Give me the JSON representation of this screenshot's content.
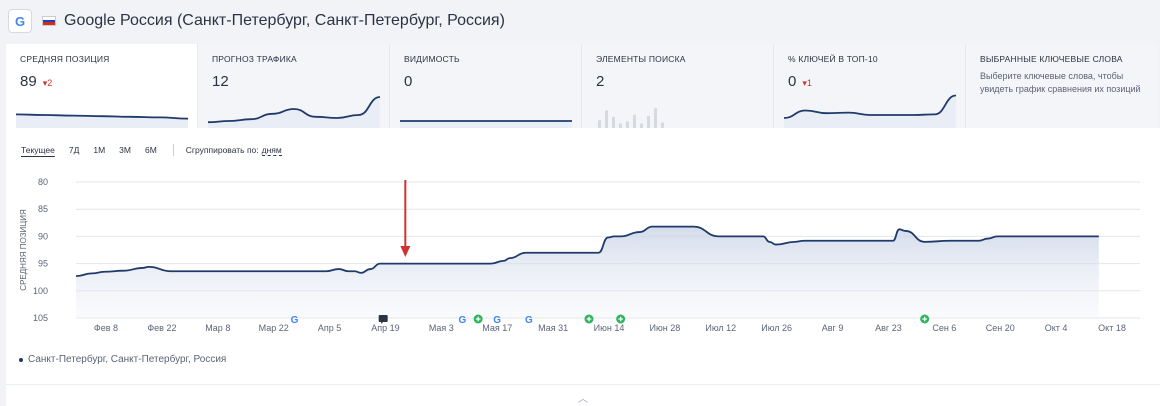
{
  "header": {
    "engine_icon": "G",
    "flag_icon": "russia-flag-icon",
    "title": "Google Россия (Санкт-Петербург, Санкт-Петербург, Россия)"
  },
  "cards": [
    {
      "label": "Средняя позиция",
      "value": "89",
      "delta": "▾2",
      "spark": [
        0.32,
        0.3,
        0.28,
        0.26,
        0.24,
        0.22,
        0.18
      ]
    },
    {
      "label": "Прогноз трафика",
      "value": "12",
      "spark": [
        0.06,
        0.1,
        0.16,
        0.34,
        0.5,
        0.24,
        0.2,
        0.3,
        0.9
      ]
    },
    {
      "label": "Видимость",
      "value": "0",
      "spark": [
        0.1,
        0.1,
        0.1,
        0.1,
        0.1,
        0.1,
        0.1
      ]
    },
    {
      "label": "Элементы поиска",
      "value": "2",
      "bars": [
        0.35,
        0.8,
        0.5,
        0.2,
        0.3,
        0.6,
        0.2,
        0.55,
        0.9,
        0.25
      ]
    },
    {
      "label": "% ключей в ТОП-10",
      "value": "0",
      "delta": "▾1",
      "spark": [
        0.2,
        0.45,
        0.36,
        0.38,
        0.3,
        0.3,
        0.3,
        0.32,
        0.95
      ]
    },
    {
      "label": "Выбранные ключевые слова",
      "note": "Выберите ключевые слова, чтобы увидеть график сравнения их позиций"
    }
  ],
  "ranges": {
    "options": [
      "Текущее",
      "7Д",
      "1М",
      "3М",
      "6М"
    ],
    "group_label": "Сгруппировать по:",
    "group_value": "дням"
  },
  "chart_data": {
    "type": "area",
    "ylabel": "Средняя позиция",
    "y_ticks": [
      80,
      85,
      90,
      95,
      100,
      105
    ],
    "ylim": [
      80,
      105
    ],
    "y_inverted": true,
    "x_ticks": [
      "Фев 8",
      "Фев 22",
      "Мар 8",
      "Мар 22",
      "Апр 5",
      "Апр 19",
      "Мая 3",
      "Мая 17",
      "Мая 31",
      "Июн 14",
      "Июн 28",
      "Июл 12",
      "Июл 26",
      "Авг 9",
      "Авг 23",
      "Сен 6",
      "Сен 20",
      "Окт 4",
      "Окт 18"
    ],
    "series": [
      {
        "name": "Санкт-Петербург, Санкт-Петербург, Россия",
        "color": "#1f3a6b",
        "x": [
          0,
          5,
          9,
          15,
          21,
          23,
          30,
          36,
          43,
          44,
          46,
          50,
          54,
          60,
          73,
          79,
          83,
          86,
          88,
          90,
          93,
          96,
          100,
          107,
          114,
          120,
          121,
          123,
          124,
          128,
          131,
          135,
          137,
          142,
          145,
          148,
          152,
          155,
          163,
          165,
          168,
          170,
          172,
          178,
          182,
          189,
          195,
          203,
          212,
          216,
          217,
          219,
          221,
          227,
          230,
          233,
          243,
          248,
          255,
          258,
          260,
          262,
          268,
          276,
          282,
          284,
          285,
          288,
          291,
          298,
          304,
          307,
          310,
          312,
          315,
          318,
          322,
          323
        ],
        "y": [
          97.3,
          96.8,
          96.5,
          96.3,
          95.8,
          95.6,
          96.4,
          96.4,
          96.4,
          96.4,
          96.4,
          96.4,
          96.4,
          96.4,
          96.4,
          96.4,
          96.0,
          96.4,
          96.4,
          96.7,
          96.0,
          95.0,
          95.0,
          95.0,
          95.0,
          95.0,
          95.0,
          95.0,
          95.0,
          95.0,
          95.0,
          94.5,
          94.0,
          93.0,
          93.0,
          93.0,
          93.0,
          93.0,
          93.0,
          93.0,
          90.2,
          90.0,
          90.0,
          89.2,
          88.2,
          88.2,
          88.2,
          90.0,
          90.0,
          90.0,
          90.0,
          91.0,
          91.5,
          91.0,
          90.8,
          90.8,
          90.8,
          90.8,
          90.8,
          90.8,
          88.7,
          89.0,
          91.0,
          90.8,
          90.8,
          90.8,
          90.8,
          90.4,
          90.0,
          90.0,
          90.0,
          90.0,
          90.0,
          90.0,
          90.0,
          90.0,
          90.0,
          90.0
        ]
      }
    ],
    "x_range": [
      0,
      336
    ],
    "legend_position": "bottom-left",
    "grid": true,
    "annotations": [
      {
        "type": "arrow",
        "x": 104,
        "color": "#d0332f"
      },
      {
        "type": "marker",
        "icon": "google-icon",
        "x": 69
      },
      {
        "type": "marker",
        "icon": "note-icon",
        "x": 97
      },
      {
        "type": "marker",
        "icon": "google-icon",
        "x": 122
      },
      {
        "type": "marker",
        "icon": "plus-icon",
        "x": 127
      },
      {
        "type": "marker",
        "icon": "google-icon",
        "x": 133
      },
      {
        "type": "marker",
        "icon": "google-icon",
        "x": 143
      },
      {
        "type": "marker",
        "icon": "plus-icon",
        "x": 162
      },
      {
        "type": "marker",
        "icon": "plus-icon",
        "x": 172
      },
      {
        "type": "marker",
        "icon": "plus-icon",
        "x": 268
      }
    ]
  },
  "colors": {
    "accent": "#1f3a6b",
    "arrow": "#d0332f",
    "marker_green": "#2fb55d",
    "google_blue": "#4285f4"
  },
  "collapse_icon": "chevron-up-icon"
}
